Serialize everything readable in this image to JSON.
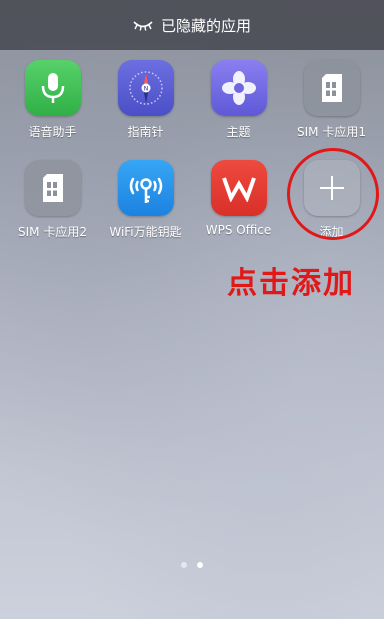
{
  "header": {
    "title": "已隐藏的应用",
    "icon": "closed-eye-icon"
  },
  "apps_row1": [
    {
      "label": "语音助手",
      "icon": "microphone-icon"
    },
    {
      "label": "指南针",
      "icon": "compass-icon"
    },
    {
      "label": "主题",
      "icon": "flower-icon"
    },
    {
      "label": "SIM 卡应用1",
      "icon": "sim-card-icon"
    }
  ],
  "apps_row2": [
    {
      "label": "SIM 卡应用2",
      "icon": "sim-card-icon"
    },
    {
      "label": "WiFi万能钥匙",
      "icon": "wifi-key-icon"
    },
    {
      "label": "WPS Office",
      "icon": "wps-icon"
    },
    {
      "label": "添加",
      "icon": "plus-icon"
    }
  ],
  "annotation": {
    "text": "点击添加",
    "color": "#e01818"
  },
  "pager": {
    "total": 2,
    "current": 2
  }
}
